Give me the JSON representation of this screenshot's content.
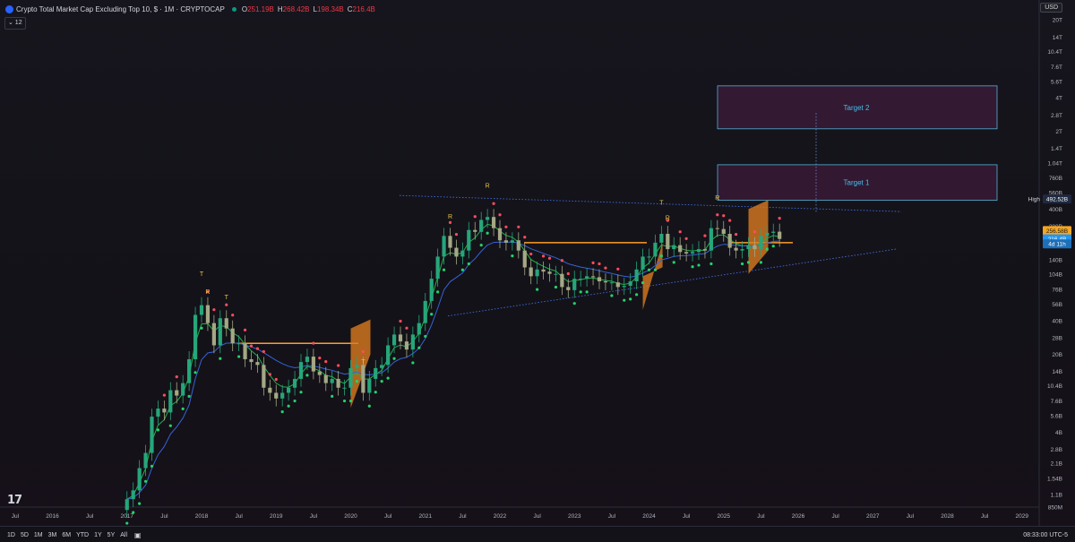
{
  "header": {
    "title": "Crypto Total Market Cap Excluding Top 10, $ · 1M · CRYPTOCAP",
    "ohlc": [
      {
        "k": "O",
        "v": "251.19B"
      },
      {
        "k": "H",
        "v": "268.42B"
      },
      {
        "k": "L",
        "v": "198.34B"
      },
      {
        "k": "C",
        "v": "216.4B"
      }
    ],
    "indicator_badge": "⌄ 12",
    "currency": "USD"
  },
  "chart_data": {
    "type": "candlestick",
    "title": "Crypto Total Market Cap Excluding Top 10, $ · 1M · CRYPTOCAP",
    "y_scale": "log",
    "y_ticks": [
      "20T",
      "14T",
      "10.4T",
      "7.6T",
      "5.6T",
      "4T",
      "2.8T",
      "2T",
      "1.4T",
      "1.04T",
      "760B",
      "560B",
      "400B",
      "280B",
      "200B",
      "140B",
      "104B",
      "76B",
      "56B",
      "40B",
      "28B",
      "20B",
      "14B",
      "10.4B",
      "7.6B",
      "5.6B",
      "4B",
      "2.8B",
      "2.1B",
      "1.54B",
      "1.1B",
      "850M"
    ],
    "x_ticks": [
      "Jul",
      "2016",
      "Jul",
      "2017",
      "Jul",
      "2018",
      "Jul",
      "2019",
      "Jul",
      "2020",
      "Jul",
      "2021",
      "Jul",
      "2022",
      "Jul",
      "2023",
      "Jul",
      "2024",
      "Jul",
      "2025",
      "Jul",
      "2026",
      "Jul",
      "2027",
      "Jul",
      "2028",
      "Jul",
      "2029"
    ],
    "price_labels": [
      {
        "label": "High",
        "value": "492.52B",
        "color": "#1f2940"
      },
      {
        "label": "",
        "value": "256.58B",
        "color": "#f5a623"
      },
      {
        "label": "",
        "value": "216.4B",
        "color": "#2196f3"
      },
      {
        "label": "",
        "value": "4d 11h",
        "color": "#1d6fb8"
      }
    ],
    "annotations": [
      {
        "text": "Target 2",
        "range_B": [
          2100,
          5100
        ]
      },
      {
        "text": "Target 1",
        "range_B": [
          480,
          1000
        ]
      }
    ],
    "markers": [
      {
        "text": "T",
        "date": "2018-01"
      },
      {
        "text": "R",
        "date": "2018-02"
      },
      {
        "text": "T",
        "date": "2018-05"
      },
      {
        "text": "R",
        "date": "2021-05"
      },
      {
        "text": "R",
        "date": "2021-11"
      },
      {
        "text": "T",
        "date": "2020-03"
      },
      {
        "text": "T",
        "date": "2024-03"
      },
      {
        "text": "R",
        "date": "2024-04"
      },
      {
        "text": "R",
        "date": "2024-12"
      }
    ],
    "series_monthly_close_B": [
      {
        "d": "2017-01",
        "v": 1.0
      },
      {
        "d": "2017-02",
        "v": 1.2
      },
      {
        "d": "2017-03",
        "v": 1.9
      },
      {
        "d": "2017-04",
        "v": 2.6
      },
      {
        "d": "2017-05",
        "v": 5.5
      },
      {
        "d": "2017-06",
        "v": 6.5
      },
      {
        "d": "2017-07",
        "v": 6.0
      },
      {
        "d": "2017-08",
        "v": 9.5
      },
      {
        "d": "2017-09",
        "v": 8.5
      },
      {
        "d": "2017-10",
        "v": 11
      },
      {
        "d": "2017-11",
        "v": 18
      },
      {
        "d": "2017-12",
        "v": 45
      },
      {
        "d": "2018-01",
        "v": 55
      },
      {
        "d": "2018-02",
        "v": 38
      },
      {
        "d": "2018-03",
        "v": 24
      },
      {
        "d": "2018-04",
        "v": 42
      },
      {
        "d": "2018-05",
        "v": 34
      },
      {
        "d": "2018-06",
        "v": 25
      },
      {
        "d": "2018-07",
        "v": 25
      },
      {
        "d": "2018-08",
        "v": 18
      },
      {
        "d": "2018-09",
        "v": 17
      },
      {
        "d": "2018-10",
        "v": 16
      },
      {
        "d": "2018-11",
        "v": 10
      },
      {
        "d": "2018-12",
        "v": 9
      },
      {
        "d": "2019-01",
        "v": 8
      },
      {
        "d": "2019-02",
        "v": 9
      },
      {
        "d": "2019-03",
        "v": 10
      },
      {
        "d": "2019-04",
        "v": 12
      },
      {
        "d": "2019-05",
        "v": 17
      },
      {
        "d": "2019-06",
        "v": 19
      },
      {
        "d": "2019-07",
        "v": 14
      },
      {
        "d": "2019-08",
        "v": 13
      },
      {
        "d": "2019-09",
        "v": 11
      },
      {
        "d": "2019-10",
        "v": 12
      },
      {
        "d": "2019-11",
        "v": 10
      },
      {
        "d": "2019-12",
        "v": 10
      },
      {
        "d": "2020-01",
        "v": 15
      },
      {
        "d": "2020-02",
        "v": 16
      },
      {
        "d": "2020-03",
        "v": 9
      },
      {
        "d": "2020-04",
        "v": 12
      },
      {
        "d": "2020-05",
        "v": 15
      },
      {
        "d": "2020-06",
        "v": 16
      },
      {
        "d": "2020-07",
        "v": 24
      },
      {
        "d": "2020-08",
        "v": 30
      },
      {
        "d": "2020-09",
        "v": 26
      },
      {
        "d": "2020-10",
        "v": 22
      },
      {
        "d": "2020-11",
        "v": 30
      },
      {
        "d": "2020-12",
        "v": 38
      },
      {
        "d": "2021-01",
        "v": 60
      },
      {
        "d": "2021-02",
        "v": 95
      },
      {
        "d": "2021-03",
        "v": 150
      },
      {
        "d": "2021-04",
        "v": 230
      },
      {
        "d": "2021-05",
        "v": 180
      },
      {
        "d": "2021-06",
        "v": 150
      },
      {
        "d": "2021-07",
        "v": 170
      },
      {
        "d": "2021-08",
        "v": 260
      },
      {
        "d": "2021-09",
        "v": 250
      },
      {
        "d": "2021-10",
        "v": 320
      },
      {
        "d": "2021-11",
        "v": 340
      },
      {
        "d": "2021-12",
        "v": 270
      },
      {
        "d": "2022-01",
        "v": 210
      },
      {
        "d": "2022-02",
        "v": 200
      },
      {
        "d": "2022-03",
        "v": 210
      },
      {
        "d": "2022-04",
        "v": 170
      },
      {
        "d": "2022-05",
        "v": 120
      },
      {
        "d": "2022-06",
        "v": 100
      },
      {
        "d": "2022-07",
        "v": 115
      },
      {
        "d": "2022-08",
        "v": 110
      },
      {
        "d": "2022-09",
        "v": 105
      },
      {
        "d": "2022-10",
        "v": 105
      },
      {
        "d": "2022-11",
        "v": 80
      },
      {
        "d": "2022-12",
        "v": 75
      },
      {
        "d": "2023-01",
        "v": 95
      },
      {
        "d": "2023-02",
        "v": 95
      },
      {
        "d": "2023-03",
        "v": 100
      },
      {
        "d": "2023-04",
        "v": 98
      },
      {
        "d": "2023-05",
        "v": 90
      },
      {
        "d": "2023-06",
        "v": 88
      },
      {
        "d": "2023-07",
        "v": 88
      },
      {
        "d": "2023-08",
        "v": 80
      },
      {
        "d": "2023-09",
        "v": 82
      },
      {
        "d": "2023-10",
        "v": 90
      },
      {
        "d": "2023-11",
        "v": 115
      },
      {
        "d": "2023-12",
        "v": 150
      },
      {
        "d": "2024-01",
        "v": 150
      },
      {
        "d": "2024-02",
        "v": 200
      },
      {
        "d": "2024-03",
        "v": 240
      },
      {
        "d": "2024-04",
        "v": 175
      },
      {
        "d": "2024-05",
        "v": 190
      },
      {
        "d": "2024-06",
        "v": 165
      },
      {
        "d": "2024-07",
        "v": 160
      },
      {
        "d": "2024-08",
        "v": 165
      },
      {
        "d": "2024-09",
        "v": 175
      },
      {
        "d": "2024-10",
        "v": 170
      },
      {
        "d": "2024-11",
        "v": 270
      },
      {
        "d": "2024-12",
        "v": 265
      },
      {
        "d": "2025-01",
        "v": 240
      },
      {
        "d": "2025-02",
        "v": 180
      },
      {
        "d": "2025-03",
        "v": 170
      },
      {
        "d": "2025-04",
        "v": 175
      },
      {
        "d": "2025-05",
        "v": 190
      },
      {
        "d": "2025-06",
        "v": 175
      },
      {
        "d": "2025-07",
        "v": 230
      },
      {
        "d": "2025-08",
        "v": 245
      },
      {
        "d": "2025-09",
        "v": 251
      },
      {
        "d": "2025-10",
        "v": 216
      }
    ]
  },
  "bottombar": {
    "timeframes": [
      "1D",
      "5D",
      "1M",
      "3M",
      "6M",
      "YTD",
      "1Y",
      "5Y",
      "All"
    ],
    "calendar_icon": "calendar-icon",
    "clock": "08:33:00 UTC-5"
  },
  "logo": "TradingView logo"
}
